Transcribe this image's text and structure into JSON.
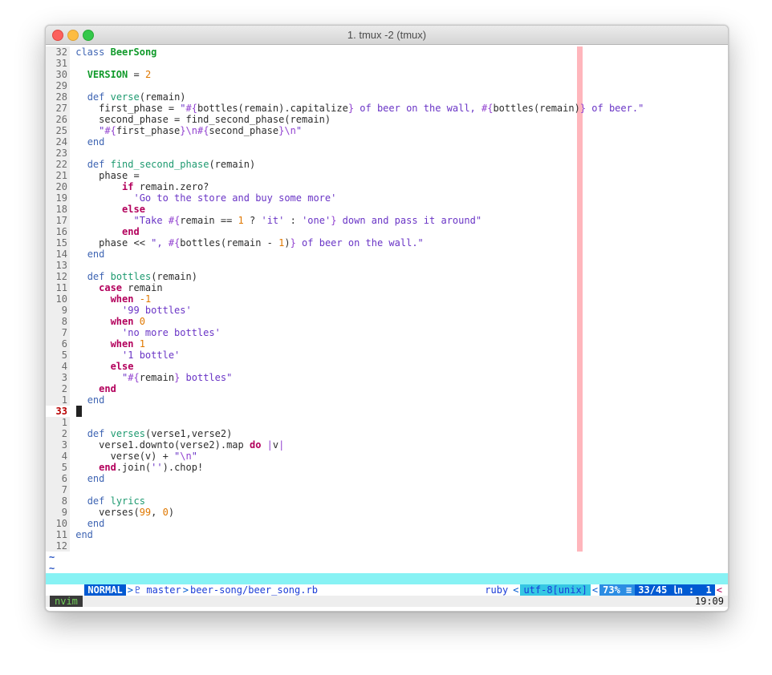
{
  "window": {
    "title": "1. tmux -2 (tmux)"
  },
  "editor": {
    "lines": [
      {
        "n": "32",
        "html": "<span class=\"kw\">class</span> <span class=\"cls\">BeerSong</span>"
      },
      {
        "n": "31",
        "html": ""
      },
      {
        "n": "30",
        "html": "  <span class=\"const\">VERSION</span> = <span class=\"num\">2</span>"
      },
      {
        "n": "29",
        "html": ""
      },
      {
        "n": "28",
        "html": "  <span class=\"kw\">def</span> <span class=\"fn\">verse</span>(remain)"
      },
      {
        "n": "27",
        "html": "    first_phase = <span class=\"str\">\"</span><span class=\"esc\">#{</span>bottles(remain).capitalize<span class=\"esc\">}</span><span class=\"str\"> of beer on the wall, </span><span class=\"esc\">#{</span>bottles(remain)<span class=\"esc\">}</span><span class=\"str\"> of beer.\"</span>"
      },
      {
        "n": "26",
        "html": "    second_phase = find_second_phase(remain)"
      },
      {
        "n": "25",
        "html": "    <span class=\"str\">\"</span><span class=\"esc\">#{</span>first_phase<span class=\"esc\">}\\n#{</span>second_phase<span class=\"esc\">}\\n</span><span class=\"str\">\"</span>"
      },
      {
        "n": "24",
        "html": "  <span class=\"kw\">end</span>"
      },
      {
        "n": "23",
        "html": ""
      },
      {
        "n": "22",
        "html": "  <span class=\"kw\">def</span> <span class=\"fn\">find_second_phase</span>(remain)"
      },
      {
        "n": "21",
        "html": "    phase ="
      },
      {
        "n": "20",
        "html": "        <span class=\"kb\">if</span> remain.zero?"
      },
      {
        "n": "19",
        "html": "          <span class=\"str\">'Go to the store and buy some more'</span>"
      },
      {
        "n": "18",
        "html": "        <span class=\"kb\">else</span>"
      },
      {
        "n": "17",
        "html": "          <span class=\"str\">\"Take </span><span class=\"esc\">#{</span>remain == <span class=\"num\">1</span> ? <span class=\"str\">'it'</span> : <span class=\"str\">'one'</span><span class=\"esc\">}</span><span class=\"str\"> down and pass it around\"</span>"
      },
      {
        "n": "16",
        "html": "        <span class=\"kb\">end</span>"
      },
      {
        "n": "15",
        "html": "    phase &lt;&lt; <span class=\"str\">\", </span><span class=\"esc\">#{</span>bottles(remain - <span class=\"num\">1</span>)<span class=\"esc\">}</span><span class=\"str\"> of beer on the wall.\"</span>"
      },
      {
        "n": "14",
        "html": "  <span class=\"kw\">end</span>"
      },
      {
        "n": "13",
        "html": ""
      },
      {
        "n": "12",
        "html": "  <span class=\"kw\">def</span> <span class=\"fn\">bottles</span>(remain)"
      },
      {
        "n": "11",
        "html": "    <span class=\"kb\">case</span> remain"
      },
      {
        "n": "10",
        "html": "      <span class=\"kb\">when</span> <span class=\"num\">-1</span>"
      },
      {
        "n": "9",
        "html": "        <span class=\"str\">'99 bottles'</span>"
      },
      {
        "n": "8",
        "html": "      <span class=\"kb\">when</span> <span class=\"num\">0</span>"
      },
      {
        "n": "7",
        "html": "        <span class=\"str\">'no more bottles'</span>"
      },
      {
        "n": "6",
        "html": "      <span class=\"kb\">when</span> <span class=\"num\">1</span>"
      },
      {
        "n": "5",
        "html": "        <span class=\"str\">'1 bottle'</span>"
      },
      {
        "n": "4",
        "html": "      <span class=\"kb\">else</span>"
      },
      {
        "n": "3",
        "html": "        <span class=\"str\">\"</span><span class=\"esc\">#{</span>remain<span class=\"esc\">}</span><span class=\"str\"> bottles\"</span>"
      },
      {
        "n": "2",
        "html": "    <span class=\"kb\">end</span>"
      },
      {
        "n": "1",
        "html": "  <span class=\"kw\">end</span>"
      },
      {
        "n": "33",
        "html": "",
        "current": true
      },
      {
        "n": "1",
        "html": ""
      },
      {
        "n": "2",
        "html": "  <span class=\"kw\">def</span> <span class=\"fn\">verses</span>(verse1,verse2)"
      },
      {
        "n": "3",
        "html": "    verse1.downto(verse2).map <span class=\"kb\">do</span> <span class=\"esc\">|</span>v<span class=\"esc\">|</span>"
      },
      {
        "n": "4",
        "html": "      verse(v) + <span class=\"str\">\"</span><span class=\"esc\">\\n</span><span class=\"str\">\"</span>"
      },
      {
        "n": "5",
        "html": "    <span class=\"kb\">end</span>.join(<span class=\"str\">''</span>).chop!"
      },
      {
        "n": "6",
        "html": "  <span class=\"kw\">end</span>"
      },
      {
        "n": "7",
        "html": ""
      },
      {
        "n": "8",
        "html": "  <span class=\"kw\">def</span> <span class=\"fn\">lyrics</span>"
      },
      {
        "n": "9",
        "html": "    verses(<span class=\"num\">99</span>, <span class=\"num\">0</span>)"
      },
      {
        "n": "10",
        "html": "  <span class=\"kw\">end</span>"
      },
      {
        "n": "11",
        "html": "<span class=\"kw\">end</span>"
      },
      {
        "n": "12",
        "html": ""
      }
    ],
    "tildes": [
      "~",
      "~"
    ]
  },
  "statusline": {
    "mode": "NORMAL",
    "sep_right": ">",
    "branch": "♇ master",
    "file": "beer-song/beer_song.rb",
    "filetype": "ruby",
    "sep_left": "<",
    "encoding": "utf-8[unix]",
    "percent": "73% ≡",
    "position": "33/45 ㏑ :  1",
    "end_arrow": "<"
  },
  "tmux": {
    "window_label": "nvim",
    "clock": "19:09"
  },
  "colors": {
    "keyword": "#3f65b3",
    "control": "#b3005c",
    "class": "#109a2a",
    "number": "#e07800",
    "string": "#6a35c6",
    "colorcolumn": "#ffb6bc",
    "status_mode_bg": "#005ad2",
    "status_bg": "#87f2f4"
  }
}
